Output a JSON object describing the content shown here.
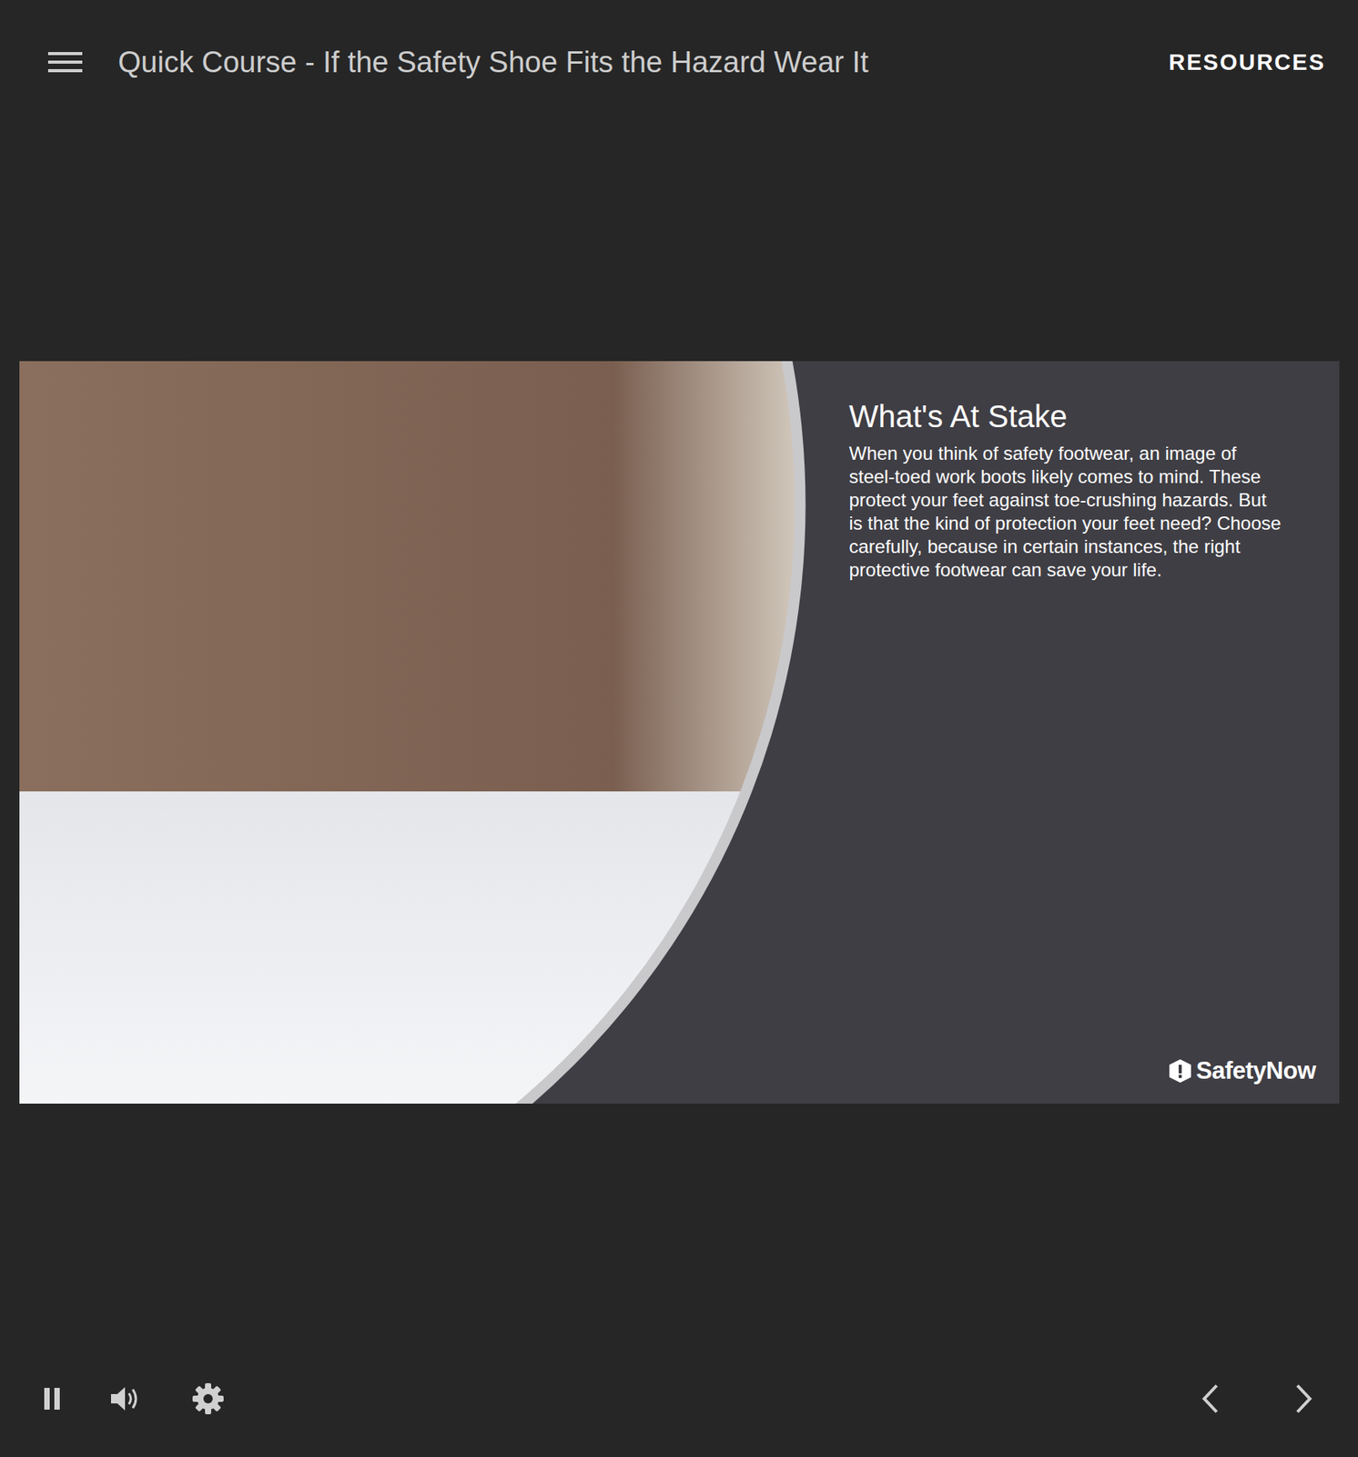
{
  "header": {
    "title": "Quick Course - If the Safety Shoe Fits the Hazard Wear It",
    "resources": "RESOURCES"
  },
  "slide": {
    "heading": "What's At Stake",
    "body": "When you think of safety footwear, an image of steel-toed work boots likely comes to mind. These protect your feet against toe-crushing hazards. But is that the kind of protection your feet need? Choose carefully, because in certain instances, the right protective footwear can save your life.",
    "logo": "SafetyNow"
  },
  "player": {
    "playing": true
  }
}
